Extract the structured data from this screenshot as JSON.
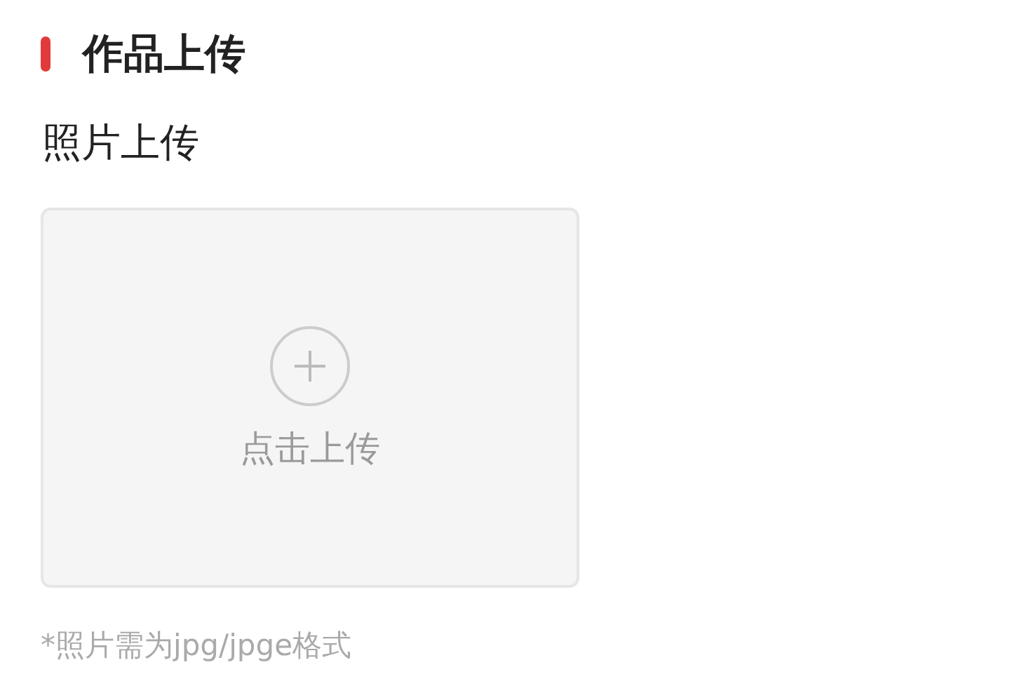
{
  "section": {
    "title": "作品上传"
  },
  "field": {
    "label": "照片上传"
  },
  "upload": {
    "label": "点击上传"
  },
  "note": "*照片需为jpg/jpge格式"
}
